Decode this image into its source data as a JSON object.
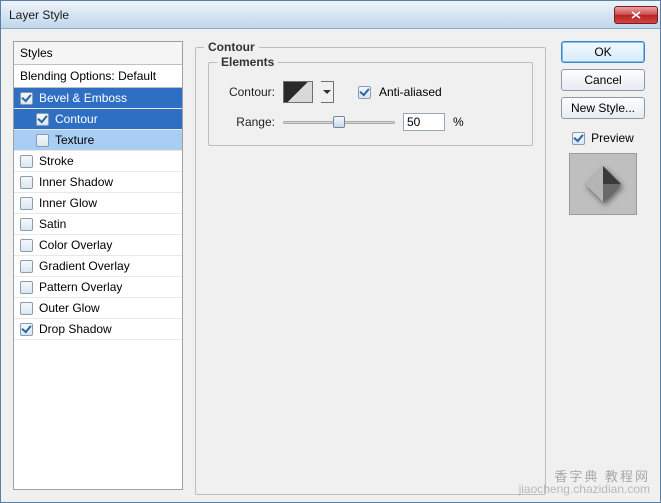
{
  "window": {
    "title": "Layer Style"
  },
  "styles": {
    "header": "Styles",
    "subheader": "Blending Options: Default",
    "items": [
      {
        "label": "Bevel & Emboss",
        "checked": true,
        "indent": false,
        "sel": "dark"
      },
      {
        "label": "Contour",
        "checked": true,
        "indent": true,
        "sel": "dark"
      },
      {
        "label": "Texture",
        "checked": false,
        "indent": true,
        "sel": "light"
      },
      {
        "label": "Stroke",
        "checked": false,
        "indent": false,
        "sel": ""
      },
      {
        "label": "Inner Shadow",
        "checked": false,
        "indent": false,
        "sel": ""
      },
      {
        "label": "Inner Glow",
        "checked": false,
        "indent": false,
        "sel": ""
      },
      {
        "label": "Satin",
        "checked": false,
        "indent": false,
        "sel": ""
      },
      {
        "label": "Color Overlay",
        "checked": false,
        "indent": false,
        "sel": ""
      },
      {
        "label": "Gradient Overlay",
        "checked": false,
        "indent": false,
        "sel": ""
      },
      {
        "label": "Pattern Overlay",
        "checked": false,
        "indent": false,
        "sel": ""
      },
      {
        "label": "Outer Glow",
        "checked": false,
        "indent": false,
        "sel": ""
      },
      {
        "label": "Drop Shadow",
        "checked": true,
        "indent": false,
        "sel": ""
      }
    ]
  },
  "main": {
    "heading": "Contour",
    "group": "Elements",
    "contour_label": "Contour:",
    "antialiased_label": "Anti-aliased",
    "antialiased_checked": true,
    "range_label": "Range:",
    "range_value": "50",
    "range_percent": 50,
    "range_unit": "%"
  },
  "buttons": {
    "ok": "OK",
    "cancel": "Cancel",
    "new_style": "New Style...",
    "preview": "Preview",
    "preview_checked": true
  },
  "watermark": {
    "line1": "香字典 教程网",
    "line2": "jiaocheng.chazidian.com"
  }
}
